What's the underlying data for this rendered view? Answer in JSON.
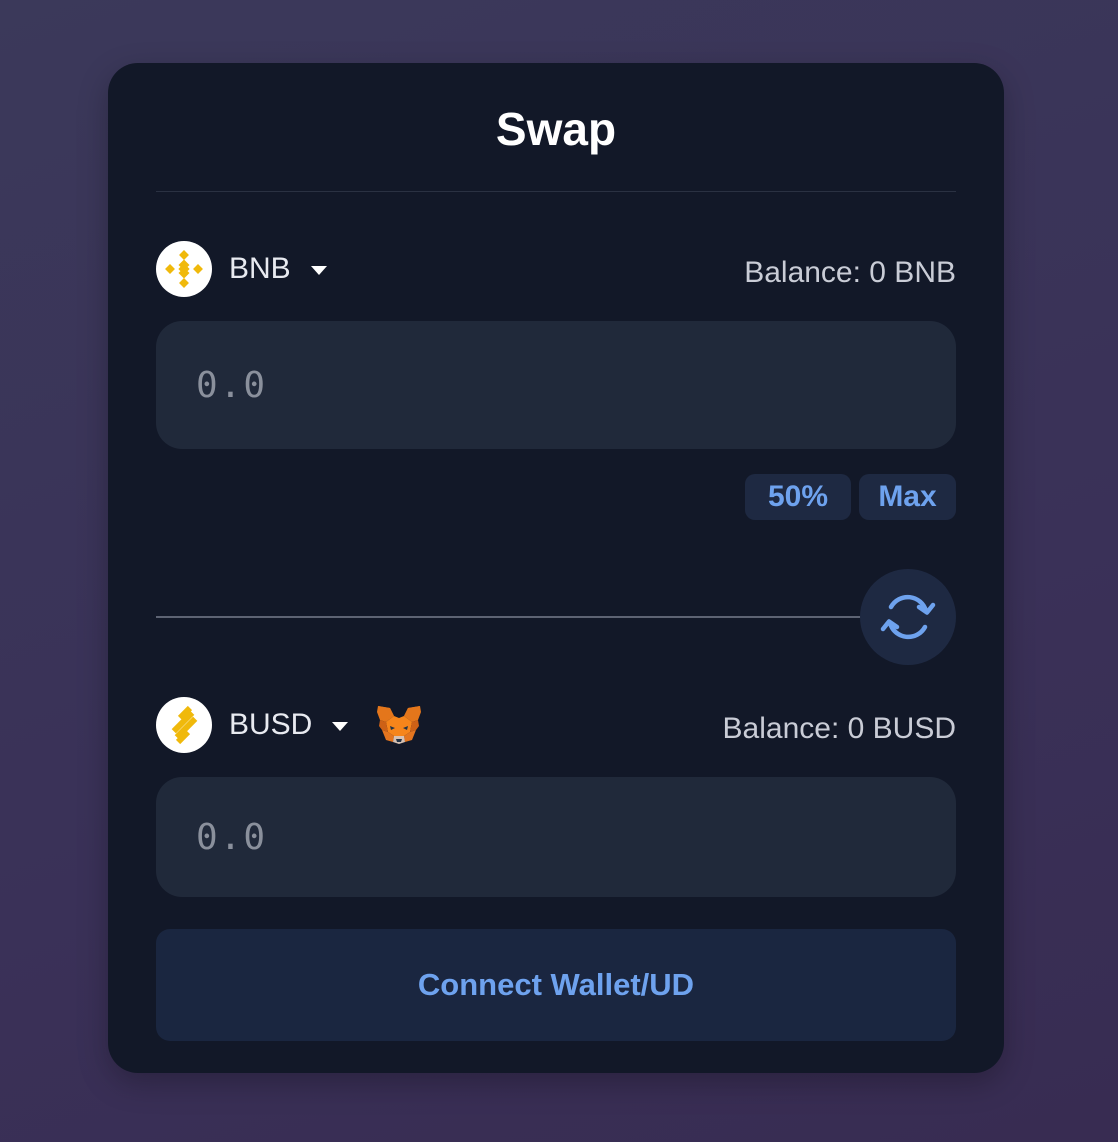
{
  "title": "Swap",
  "from": {
    "symbol": "BNB",
    "balance": "Balance: 0 BNB",
    "placeholder": "0.0",
    "logo_icon": "bnb-logo-icon",
    "logo_color": "#F0B90B"
  },
  "quick_amounts": {
    "half": "50%",
    "max": "Max"
  },
  "to": {
    "symbol": "BUSD",
    "balance": "Balance: 0 BUSD",
    "placeholder": "0.0",
    "logo_icon": "busd-logo-icon",
    "logo_color": "#F0B90B",
    "wallet_icon": "metamask-fox-icon"
  },
  "switch_icon": "swap-arrows-icon",
  "connect_button": "Connect Wallet/UD",
  "colors": {
    "accent": "#6EA2EE",
    "card": "#121828",
    "input_bg": "#20293A",
    "button_bg": "#1A2640"
  }
}
